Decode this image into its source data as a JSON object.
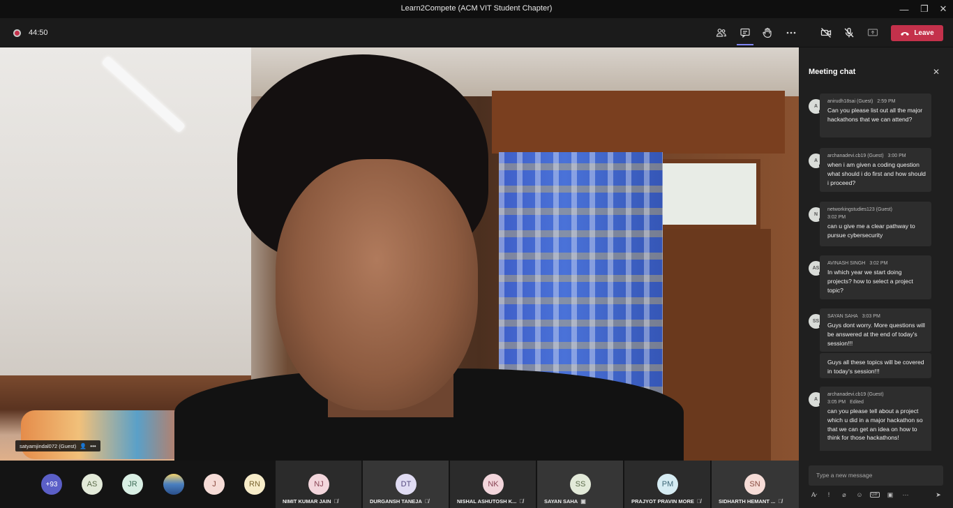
{
  "window": {
    "title": "Learn2Compete (ACM VIT Student Chapter)",
    "minimize": "—",
    "maximize": "❐",
    "close": "✕"
  },
  "toolbar": {
    "timer": "44:50",
    "leave_label": "Leave",
    "icons": [
      "participants-icon",
      "chat-icon",
      "raise-hand-icon",
      "more-icon",
      "camera-off-icon",
      "mic-off-icon",
      "share-icon"
    ]
  },
  "video": {
    "speaker_name": "satyamjindal072 (Guest)"
  },
  "chat": {
    "title": "Meeting chat",
    "compose_placeholder": "Type a new message",
    "messages": [
      {
        "initials": "A",
        "sender": "anirudh18sai (Guest)",
        "time": "2:59 PM",
        "presence": "#c4314b",
        "text": "Can you please list out all the major hackathons that we can attend?"
      },
      {
        "initials": "A",
        "sender": "archanadevi.cb19 (Guest)",
        "time": "3:00 PM",
        "presence": "#92c353",
        "text": "when i am given a coding question what should i do first and how should i proceed?"
      },
      {
        "initials": "N",
        "sender": "networkingstudies123 (Guest)",
        "time": "3:02 PM",
        "presence": "#c4314b",
        "text": "can u give me a clear pathway to pursue cybersecurity"
      },
      {
        "initials": "AS",
        "sender": "AVINASH SINGH",
        "time": "3:02 PM",
        "presence": "#92c353",
        "text": "In which year we start doing projects? how to select a project topic?"
      },
      {
        "initials": "SS",
        "sender": "SAYAN SAHA",
        "time": "3:03 PM",
        "presence": "#c4314b",
        "text": "Guys dont worry. More questions will be answered at the end of today's session!!!",
        "followup": "Guys all these topics will be covered in today's session!!!"
      },
      {
        "initials": "A",
        "sender": "archanadevi.cb19 (Guest)",
        "time": "3:05 PM",
        "edited": "Edited",
        "presence": "#92c353",
        "text": "can you please tell about a project which u did in a major hackathon so that we can get an idea on how to think for those hackathons!"
      }
    ]
  },
  "participants": {
    "overflow": "+93",
    "bubbles": [
      {
        "initials": "AS",
        "bg": "#e3ead9",
        "fg": "#5b6b4a"
      },
      {
        "initials": "JR",
        "bg": "#d9efe4",
        "fg": "#3f6d57"
      },
      {
        "initials": "",
        "bg": "#4a7fc0",
        "fg": "#fff"
      },
      {
        "initials": "J",
        "bg": "#f6dcd7",
        "fg": "#8a4b40"
      },
      {
        "initials": "RN",
        "bg": "#f7ecc9",
        "fg": "#7a6530"
      }
    ],
    "tiles": [
      {
        "initials": "NJ",
        "name": "NIMIT KUMAR JAIN",
        "bg": "#f3d6dc",
        "fg": "#8a4455"
      },
      {
        "initials": "DT",
        "name": "DURGANSH TANEJA",
        "bg": "#e0dcf3",
        "fg": "#54497f"
      },
      {
        "initials": "NK",
        "name": "NISHAL ASHUTOSH K...",
        "bg": "#f3d6dc",
        "fg": "#8a4455"
      },
      {
        "initials": "SS",
        "name": "SAYAN SAHA",
        "bg": "#e3ead9",
        "fg": "#5b6b4a"
      },
      {
        "initials": "PM",
        "name": "PRAJYOT PRAVIN MORE",
        "bg": "#d6ecf3",
        "fg": "#3e6878"
      },
      {
        "initials": "SN",
        "name": "SIDHARTH HEMANT ...",
        "bg": "#f6dcd7",
        "fg": "#8a4b40"
      }
    ]
  }
}
